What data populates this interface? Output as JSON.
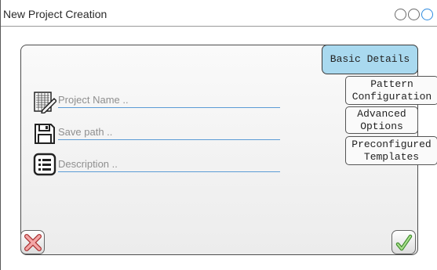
{
  "window": {
    "title": "New Project Creation"
  },
  "form": {
    "project_name_placeholder": "Project Name ..",
    "save_path_placeholder": "Save path ..",
    "description_placeholder": "Description .."
  },
  "tabs": [
    {
      "label": "Basic Details",
      "active": true
    },
    {
      "label": "Pattern Configuration",
      "active": false
    },
    {
      "label": "Advanced Options",
      "active": false
    },
    {
      "label": "Preconfigured Templates",
      "active": false
    }
  ],
  "colors": {
    "active_tab": "#a9d9ef",
    "field_underline": "#5b9bd5",
    "cancel": "#e06b6b",
    "confirm": "#6cbf4a"
  },
  "icons": {
    "project_name": "document-pencil-icon",
    "save_path": "floppy-disk-icon",
    "description": "list-icon",
    "cancel": "close-x-icon",
    "confirm": "checkmark-icon"
  }
}
